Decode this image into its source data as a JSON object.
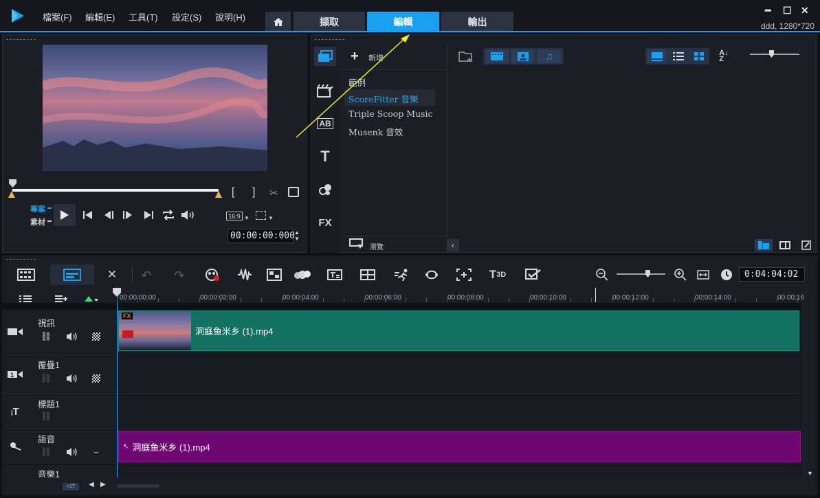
{
  "titlebar": {
    "menus": [
      "檔案(F)",
      "編輯(E)",
      "工具(T)",
      "設定(S)",
      "說明(H)"
    ],
    "tabs": [
      "擷取",
      "編輯",
      "輸出"
    ],
    "active_tab": "編輯",
    "project_info": "ddd, 1280*720",
    "icons": [
      "app-logo-icon",
      "home-icon",
      "minimize-icon",
      "maximize-icon",
      "close-icon"
    ]
  },
  "preview": {
    "mode_project": "專案",
    "mode_clip": "素材",
    "aspect": "16:9",
    "timecode": "00:00:00:000"
  },
  "library": {
    "add_label": "新增",
    "items": [
      "範例",
      "ScoreFitter 音樂",
      "Triple Scoop Music",
      "Musenk 音效"
    ],
    "selected": "ScoreFitter 音樂",
    "browse_label": "瀏覽",
    "side_fx_label": "FX"
  },
  "timeline": {
    "duration": "0:04:04:02",
    "ruler": [
      "00:00:00:00",
      "00:00:02:00",
      "00:00:04:00",
      "00:00:06:00",
      "00:00:08:00",
      "00:00:10:00",
      "00:00:12:00",
      "00:00:14:00",
      "00:00:16"
    ],
    "tracks": [
      {
        "name": "視訊"
      },
      {
        "name": "覆疊1"
      },
      {
        "name": "標題1"
      },
      {
        "name": "語音"
      },
      {
        "name": "音樂1"
      }
    ],
    "video_clip": "洞庭鱼米乡 (1).mp4",
    "voice_clip": "洞庭鱼米乡 (1).mp4",
    "fx_badge": "FX",
    "accent": "#1aa0f0",
    "video_clip_color": "#137162",
    "voice_clip_color": "#700672"
  }
}
